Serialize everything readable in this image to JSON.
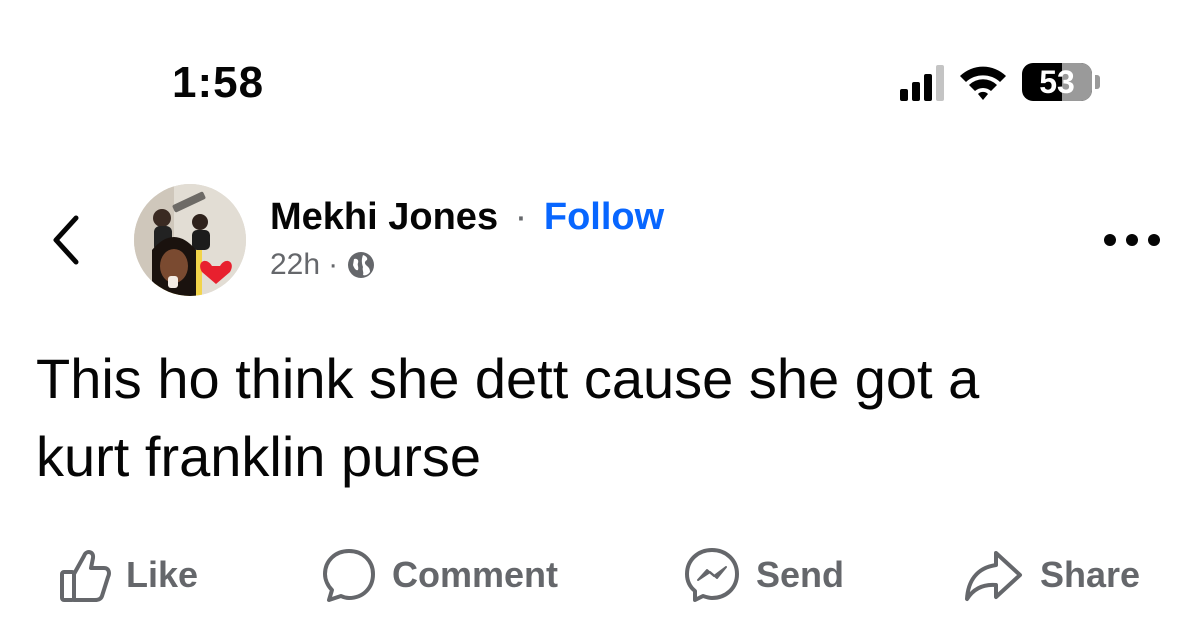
{
  "status_bar": {
    "time": "1:58",
    "battery_level": "53",
    "signal_bars_active": 3,
    "signal_bars_total": 4
  },
  "post": {
    "author": "Mekhi Jones",
    "separator": "·",
    "follow_label": "Follow",
    "timestamp": "22h",
    "meta_separator": "·",
    "privacy_icon": "globe-icon",
    "text_lines": [
      "This ho think she dett cause she got a",
      "kurt franklin purse"
    ]
  },
  "actions": {
    "like": "Like",
    "comment": "Comment",
    "send": "Send",
    "share": "Share"
  },
  "colors": {
    "text_primary": "#050505",
    "text_secondary": "#65676b",
    "link_blue": "#0866ff"
  }
}
